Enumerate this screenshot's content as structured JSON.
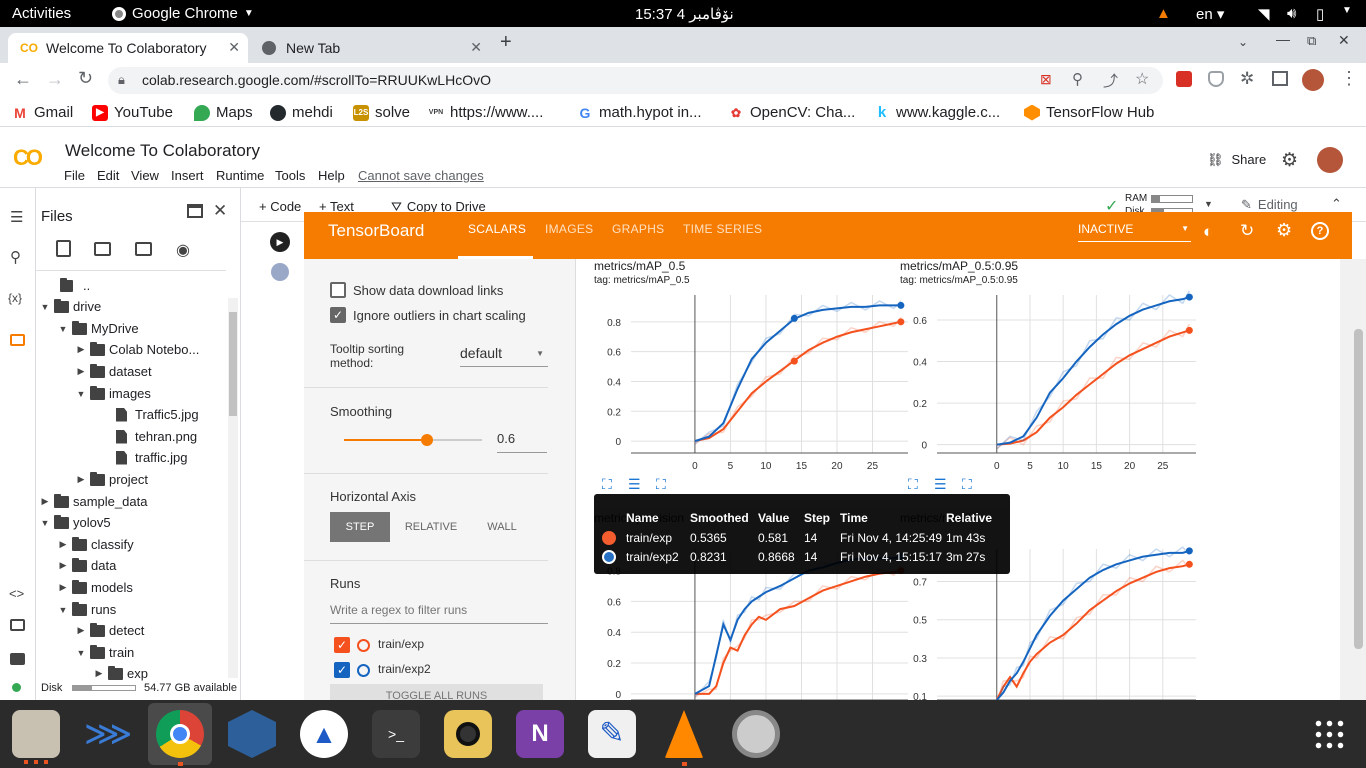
{
  "os": {
    "activities": "Activities",
    "app_menu": "Google Chrome",
    "clock": "15:37  4 نۆڤامبر",
    "lang": "en"
  },
  "browser": {
    "tabs": [
      {
        "label": "Welcome To Colaboratory"
      },
      {
        "label": "New Tab"
      }
    ],
    "url": "colab.research.google.com/#scrollTo=RRUUKwLHcOvO",
    "bookmarks": [
      {
        "label": "Gmail"
      },
      {
        "label": "YouTube"
      },
      {
        "label": "Maps"
      },
      {
        "label": "mehdi"
      },
      {
        "label": "solve"
      },
      {
        "label": "https://www...."
      },
      {
        "label": "math.hypot in..."
      },
      {
        "label": "OpenCV: Cha..."
      },
      {
        "label": "www.kaggle.c..."
      },
      {
        "label": "TensorFlow Hub"
      }
    ]
  },
  "colab": {
    "title": "Welcome To Colaboratory",
    "menu": [
      "File",
      "Edit",
      "View",
      "Insert",
      "Runtime",
      "Tools",
      "Help"
    ],
    "cannot_save": "Cannot save changes",
    "share": "Share",
    "code_btn": "+ Code",
    "text_btn": "+ Text",
    "copy_drive": "Copy to Drive",
    "ram": "RAM",
    "disk": "Disk",
    "editing": "Editing"
  },
  "files": {
    "title": "Files",
    "tree": [
      {
        "label": "..",
        "indent": 0
      },
      {
        "label": "drive"
      },
      {
        "label": "MyDrive"
      },
      {
        "label": "Colab Notebo..."
      },
      {
        "label": "dataset"
      },
      {
        "label": "images"
      },
      {
        "label": "Traffic5.jpg"
      },
      {
        "label": "tehran.png"
      },
      {
        "label": "traffic.jpg"
      },
      {
        "label": "project"
      },
      {
        "label": "sample_data"
      },
      {
        "label": "yolov5"
      },
      {
        "label": "classify"
      },
      {
        "label": "data"
      },
      {
        "label": "models"
      },
      {
        "label": "runs"
      },
      {
        "label": "detect"
      },
      {
        "label": "train"
      },
      {
        "label": "exp"
      }
    ],
    "disk_label": "Disk",
    "disk_avail": "54.77 GB available"
  },
  "tensorboard": {
    "logo": "TensorBoard",
    "tabs": [
      "SCALARS",
      "IMAGES",
      "GRAPHS",
      "TIME SERIES"
    ],
    "status": "INACTIVE",
    "show_download": "Show data download links",
    "ignore_outliers": "Ignore outliers in chart scaling",
    "tooltip_sort_label": "Tooltip sorting method:",
    "tooltip_sort_value": "default",
    "smoothing_label": "Smoothing",
    "smoothing_value": "0.6",
    "smoothing_fraction": 0.6,
    "haxis_label": "Horizontal Axis",
    "haxis_options": [
      "STEP",
      "RELATIVE",
      "WALL"
    ],
    "runs_label": "Runs",
    "runs_filter_placeholder": "Write a regex to filter runs",
    "runs": [
      {
        "name": "train/exp",
        "color": "#f4511e",
        "checked": true
      },
      {
        "name": "train/exp2",
        "color": "#1565c0",
        "checked": true
      }
    ],
    "toggle_all": "TOGGLE ALL RUNS"
  },
  "tooltip": {
    "headers": [
      "Name",
      "Smoothed",
      "Value",
      "Step",
      "Time",
      "Relative"
    ],
    "rows": [
      [
        "train/exp",
        "0.5365",
        "0.581",
        "14",
        "Fri Nov 4, 14:25:49",
        "1m 43s"
      ],
      [
        "train/exp2",
        "0.8231",
        "0.8668",
        "14",
        "Fri Nov 4, 15:15:17",
        "3m 27s"
      ]
    ]
  },
  "chart_data": [
    {
      "type": "line",
      "title": "metrics/mAP_0.5",
      "subtitle": "tag: metrics/mAP_0.5",
      "xticks": [
        "0",
        "5",
        "10",
        "15",
        "20",
        "25"
      ],
      "yticks": [
        "0",
        "0.2",
        "0.4",
        "0.6",
        "0.8"
      ],
      "xlim": [
        -9,
        30
      ],
      "ylim": [
        -0.08,
        0.98
      ],
      "x": [
        0,
        2,
        4,
        6,
        8,
        10,
        12,
        14,
        16,
        18,
        20,
        22,
        24,
        26,
        28,
        29
      ],
      "series": [
        {
          "name": "train/exp",
          "color": "#f4511e",
          "values": [
            0,
            0.02,
            0.08,
            0.2,
            0.32,
            0.4,
            0.47,
            0.54,
            0.61,
            0.66,
            0.7,
            0.73,
            0.75,
            0.77,
            0.79,
            0.8
          ]
        },
        {
          "name": "train/exp2",
          "color": "#1565c0",
          "values": [
            0,
            0.03,
            0.12,
            0.35,
            0.55,
            0.66,
            0.74,
            0.82,
            0.86,
            0.88,
            0.89,
            0.9,
            0.9,
            0.91,
            0.91,
            0.91
          ]
        }
      ]
    },
    {
      "type": "line",
      "title": "metrics/mAP_0.5:0.95",
      "subtitle": "tag: metrics/mAP_0.5:0.95",
      "xticks": [
        "0",
        "5",
        "10",
        "15",
        "20",
        "25"
      ],
      "yticks": [
        "0",
        "0.2",
        "0.4",
        "0.6"
      ],
      "xlim": [
        -9,
        30
      ],
      "ylim": [
        -0.04,
        0.72
      ],
      "x": [
        0,
        2,
        4,
        6,
        8,
        10,
        12,
        14,
        16,
        18,
        20,
        22,
        24,
        26,
        28,
        29
      ],
      "series": [
        {
          "name": "train/exp",
          "color": "#f4511e",
          "values": [
            0,
            0.005,
            0.02,
            0.06,
            0.13,
            0.18,
            0.24,
            0.29,
            0.34,
            0.39,
            0.43,
            0.46,
            0.49,
            0.52,
            0.54,
            0.55
          ]
        },
        {
          "name": "train/exp2",
          "color": "#1565c0",
          "values": [
            0,
            0.01,
            0.04,
            0.13,
            0.25,
            0.32,
            0.4,
            0.47,
            0.53,
            0.58,
            0.62,
            0.65,
            0.67,
            0.69,
            0.7,
            0.71
          ]
        }
      ]
    },
    {
      "type": "line",
      "title": "metrics/precision",
      "xticks": [],
      "yticks": [
        "0",
        "0.2",
        "0.4",
        "0.6",
        "0.8"
      ],
      "xlim": [
        -9,
        30
      ],
      "ylim": [
        -0.04,
        0.94
      ],
      "x": [
        0,
        2,
        3,
        4,
        5,
        6,
        7,
        8,
        9,
        10,
        12,
        14,
        16,
        18,
        20,
        22,
        24,
        26,
        28,
        29
      ],
      "series": [
        {
          "name": "train/exp",
          "color": "#f4511e",
          "values": [
            0,
            0,
            0.05,
            0.2,
            0.3,
            0.28,
            0.38,
            0.45,
            0.5,
            0.48,
            0.55,
            0.57,
            0.62,
            0.67,
            0.7,
            0.73,
            0.76,
            0.78,
            0.79,
            0.8
          ]
        },
        {
          "name": "train/exp2",
          "color": "#1565c0",
          "values": [
            0,
            0.05,
            0.25,
            0.45,
            0.35,
            0.48,
            0.55,
            0.6,
            0.63,
            0.66,
            0.7,
            0.75,
            0.8,
            0.82,
            0.85,
            0.87,
            0.88,
            0.88,
            0.88,
            0.89
          ]
        }
      ]
    },
    {
      "type": "line",
      "title": "metrics/recall",
      "xticks": [],
      "yticks": [
        "0.1",
        "0.3",
        "0.5",
        "0.7"
      ],
      "xlim": [
        -9,
        30
      ],
      "ylim": [
        0.08,
        0.87
      ],
      "x": [
        0,
        1,
        2,
        3,
        4,
        5,
        6,
        8,
        10,
        12,
        14,
        16,
        18,
        20,
        22,
        24,
        26,
        28,
        29
      ],
      "series": [
        {
          "name": "train/exp",
          "color": "#f4511e",
          "values": [
            0.08,
            0.15,
            0.2,
            0.15,
            0.22,
            0.28,
            0.32,
            0.38,
            0.42,
            0.48,
            0.55,
            0.6,
            0.65,
            0.69,
            0.72,
            0.75,
            0.77,
            0.78,
            0.79
          ]
        },
        {
          "name": "train/exp2",
          "color": "#1565c0",
          "values": [
            0.08,
            0.12,
            0.18,
            0.22,
            0.28,
            0.35,
            0.42,
            0.52,
            0.6,
            0.66,
            0.72,
            0.76,
            0.79,
            0.81,
            0.83,
            0.84,
            0.85,
            0.85,
            0.86
          ]
        }
      ]
    }
  ]
}
